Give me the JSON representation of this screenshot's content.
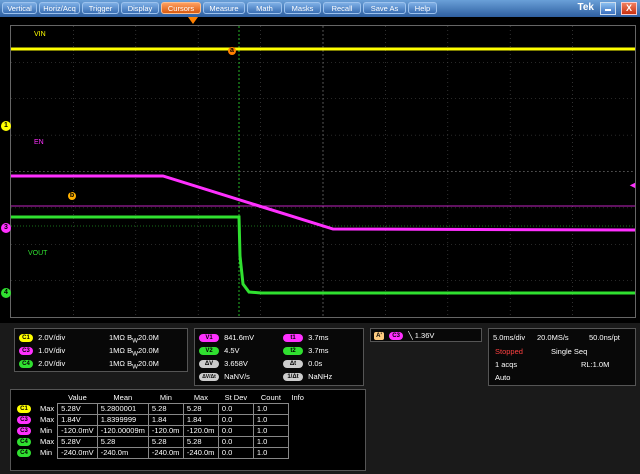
{
  "menu": {
    "items": [
      "Vertical",
      "Horiz/Acq",
      "Trigger",
      "Display",
      "Cursors",
      "Measure",
      "Math",
      "Masks",
      "Recall",
      "Save As",
      "Help"
    ],
    "active": "Cursors",
    "brand": "Tek",
    "close_symbol": "X"
  },
  "waveform_labels": {
    "vin": "VIN",
    "en": "EN",
    "vout": "VOUT"
  },
  "markers": {
    "ch1": "1",
    "ch3": "3",
    "ch4": "4",
    "cursor_a": "a",
    "cursor_b": "b",
    "trigger": "T"
  },
  "colors": {
    "ch1": "#ffff00",
    "ch3": "#ff30ff",
    "ch4": "#30e030",
    "cursor_a": "#ff8000",
    "cursor_b": "#ffb000",
    "grid": "#505050",
    "background": "#000000"
  },
  "channels": [
    {
      "tag": "C1",
      "scale": "2.0V/div",
      "impedance": "1MΩ",
      "bw": "20.0M",
      "color": "#ffff00"
    },
    {
      "tag": "C3",
      "scale": "1.0V/div",
      "impedance": "1MΩ",
      "bw": "20.0M",
      "color": "#ff30ff"
    },
    {
      "tag": "C4",
      "scale": "2.0V/div",
      "impedance": "1MΩ",
      "bw": "20.0M",
      "color": "#30e030"
    }
  ],
  "bw_prefix": "B",
  "bw_sub": "W",
  "cursors": {
    "v1": {
      "label": "V1",
      "value": "841.6mV"
    },
    "v2": {
      "label": "V2",
      "value": "4.5V"
    },
    "dv": {
      "label": "ΔV",
      "value": "3.658V"
    },
    "dvdt": {
      "label": "ΔV/Δt",
      "value": "NaNV/s"
    },
    "t1": {
      "label": "t1",
      "value": "3.7ms"
    },
    "t2": {
      "label": "t2",
      "value": "3.7ms"
    },
    "dt": {
      "label": "Δt",
      "value": "0.0s"
    },
    "inv_dt": {
      "label": "1/Δt",
      "value": "NaNHz"
    }
  },
  "trigger": {
    "mode_tag": "A'",
    "source": "C3",
    "slope": "falling",
    "level": "1.36V"
  },
  "horizontal": {
    "scale": "5.0ms/div",
    "rate": "20.0MS/s",
    "resolution": "50.0ns/pt",
    "state": "Stopped",
    "mode": "Single Seq",
    "acqs": "1 acqs",
    "record": "RL:1.0M",
    "auto": "Auto"
  },
  "measurements": {
    "headers": [
      "",
      "",
      "Value",
      "Mean",
      "Min",
      "Max",
      "St Dev",
      "Count",
      "Info"
    ],
    "rows": [
      {
        "tag": "C1",
        "color": "#ffff00",
        "name": "Max",
        "value": "5.28V",
        "mean": "5.2800001",
        "min": "5.28",
        "max": "5.28",
        "stdev": "0.0",
        "count": "1.0",
        "info": ""
      },
      {
        "tag": "C3",
        "color": "#ff30ff",
        "name": "Max",
        "value": "1.84V",
        "mean": "1.8399999",
        "min": "1.84",
        "max": "1.84",
        "stdev": "0.0",
        "count": "1.0",
        "info": ""
      },
      {
        "tag": "C3",
        "color": "#ff30ff",
        "name": "Min",
        "value": "-120.0mV",
        "mean": "-120.00009m",
        "min": "-120.0m",
        "max": "-120.0m",
        "stdev": "0.0",
        "count": "1.0",
        "info": ""
      },
      {
        "tag": "C4",
        "color": "#30e030",
        "name": "Max",
        "value": "5.28V",
        "mean": "5.28",
        "min": "5.28",
        "max": "5.28",
        "stdev": "0.0",
        "count": "1.0",
        "info": ""
      },
      {
        "tag": "C4",
        "color": "#30e030",
        "name": "Min",
        "value": "-240.0mV",
        "mean": "-240.0m",
        "min": "-240.0m",
        "max": "-240.0m",
        "stdev": "0.0",
        "count": "1.0",
        "info": ""
      }
    ]
  }
}
